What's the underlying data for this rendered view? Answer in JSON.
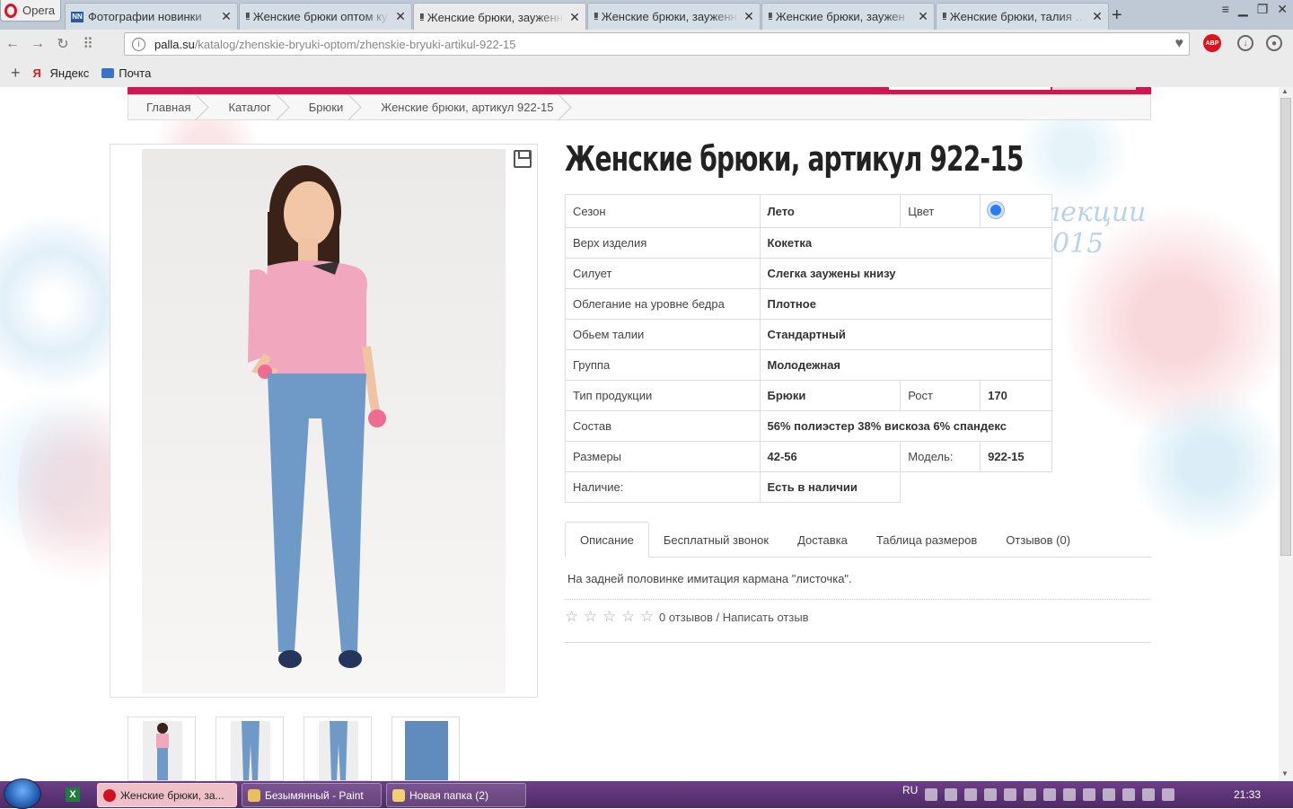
{
  "browser": {
    "menu_label": "Opera",
    "tabs": [
      {
        "title": "Фотографии новинки",
        "icon": "nn-favicon"
      },
      {
        "title": "Женские брюки оптом ку",
        "icon": "palla-favicon"
      },
      {
        "title": "Женские брюки, зауженн",
        "icon": "palla-favicon",
        "active": true
      },
      {
        "title": "Женские брюки, зауженн",
        "icon": "palla-favicon"
      },
      {
        "title": "Женские брюки, заужен",
        "icon": "palla-favicon"
      },
      {
        "title": "Женские брюки, талия ул",
        "icon": "palla-favicon"
      }
    ],
    "url_host": "palla.su",
    "url_path": "/katalog/zhenskie-bryuki-optom/zhenskie-bryuki-artikul-922-15",
    "abp_label": "ABP",
    "bookmarks": [
      {
        "label": "Яндекс",
        "icon": "yandex-icon"
      },
      {
        "label": "Почта",
        "icon": "mail-icon"
      }
    ]
  },
  "page": {
    "breadcrumbs": [
      "Главная",
      "Каталог",
      "Брюки",
      "Женские брюки, артикул 922-15"
    ],
    "bg_text_line1": "лекции",
    "bg_text_line2": "015",
    "title": "Женские брюки, артикул 922-15",
    "spec": {
      "season_label": "Сезон",
      "season": "Лето",
      "color_label": "Цвет",
      "color_swatch": "#2a7bf0",
      "top_label": "Верх изделия",
      "top": "Кокетка",
      "silhouette_label": "Силует",
      "silhouette": "Слегка заужены книзу",
      "fit_label": "Облегание на уровне бедра",
      "fit": "Плотное",
      "waist_label": "Обьем талии",
      "waist": "Стандартный",
      "group_label": "Группа",
      "group": "Молодежная",
      "type_label": "Тип продукции",
      "type": "Брюки",
      "height_label": "Рост",
      "height": "170",
      "composition_label": "Состав",
      "composition": "56% полиэстер 38% вискоза 6% спандекс",
      "sizes_label": "Размеры",
      "sizes": "42-56",
      "model_label": "Модель:",
      "model": "922-15",
      "availability_label": "Наличие:",
      "availability": "Есть в наличии"
    },
    "tabs": [
      "Описание",
      "Бесплатный звонок",
      "Доставка",
      "Таблица размеров",
      "Отзывов (0)"
    ],
    "description": "На задней половинке имитация кармана \"листочка\".",
    "reviews_text": "0 отзывов / Написать отзыв"
  },
  "taskbar": {
    "items": [
      {
        "label": "Женские брюки, за...",
        "icon": "opera-icon",
        "active": true
      },
      {
        "label": "Безымянный - Paint",
        "icon": "paint-icon"
      },
      {
        "label": "Новая папка (2)",
        "icon": "folder-icon"
      }
    ],
    "lang": "RU",
    "time": "21:33"
  },
  "colors": {
    "brand": "#d6154f",
    "taskbar": "#5a3275",
    "tab_bar": "#bfc9d6"
  }
}
